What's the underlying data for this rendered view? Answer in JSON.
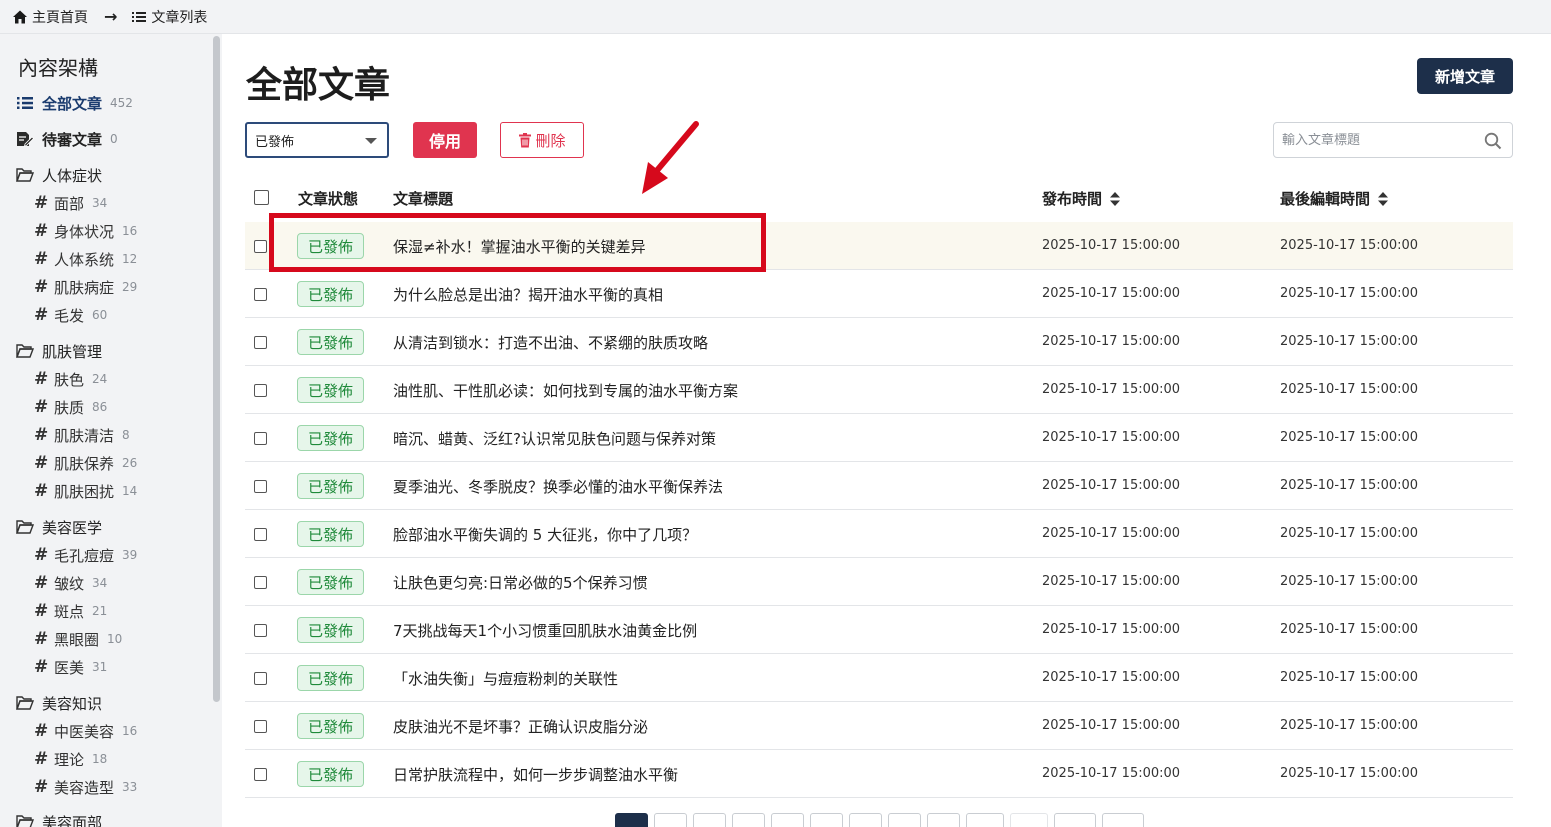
{
  "breadcrumb": {
    "home": "主頁首頁",
    "current": "文章列表"
  },
  "sidebar": {
    "title": "內容架構",
    "all": {
      "label": "全部文章",
      "count": "452"
    },
    "pending": {
      "label": "待審文章",
      "count": "0"
    },
    "groups": [
      {
        "label": "人体症状",
        "items": [
          {
            "label": "面部",
            "count": "34"
          },
          {
            "label": "身体状况",
            "count": "16"
          },
          {
            "label": "人体系统",
            "count": "12"
          },
          {
            "label": "肌肤病症",
            "count": "29"
          },
          {
            "label": "毛发",
            "count": "60"
          }
        ]
      },
      {
        "label": "肌肤管理",
        "items": [
          {
            "label": "肤色",
            "count": "24"
          },
          {
            "label": "肤质",
            "count": "86"
          },
          {
            "label": "肌肤清洁",
            "count": "8"
          },
          {
            "label": "肌肤保养",
            "count": "26"
          },
          {
            "label": "肌肤困扰",
            "count": "14"
          }
        ]
      },
      {
        "label": "美容医学",
        "items": [
          {
            "label": "毛孔痘痘",
            "count": "39"
          },
          {
            "label": "皱纹",
            "count": "34"
          },
          {
            "label": "斑点",
            "count": "21"
          },
          {
            "label": "黑眼圈",
            "count": "10"
          },
          {
            "label": "医美",
            "count": "31"
          }
        ]
      },
      {
        "label": "美容知识",
        "items": [
          {
            "label": "中医美容",
            "count": "16"
          },
          {
            "label": "理论",
            "count": "18"
          },
          {
            "label": "美容造型",
            "count": "33"
          }
        ]
      },
      {
        "label": "美容面部",
        "items": []
      }
    ]
  },
  "page": {
    "title": "全部文章",
    "new_button": "新增文章"
  },
  "toolbar": {
    "status_value": "已發佈",
    "disable_label": "停用",
    "delete_label": "刪除",
    "search_placeholder": "輸入文章標題"
  },
  "table": {
    "headers": {
      "status": "文章狀態",
      "title": "文章標題",
      "published": "發布時間",
      "edited": "最後編輯時間"
    },
    "rows": [
      {
        "status": "已發佈",
        "title": "保湿≠补水！掌握油水平衡的关键差异",
        "published": "2025-10-17 15:00:00",
        "edited": "2025-10-17 15:00:00"
      },
      {
        "status": "已發佈",
        "title": "为什么脸总是出油？揭开油水平衡的真相",
        "published": "2025-10-17 15:00:00",
        "edited": "2025-10-17 15:00:00"
      },
      {
        "status": "已發佈",
        "title": "从清洁到锁水：打造不出油、不紧绷的肤质攻略",
        "published": "2025-10-17 15:00:00",
        "edited": "2025-10-17 15:00:00"
      },
      {
        "status": "已發佈",
        "title": "油性肌、干性肌必读：如何找到专属的油水平衡方案",
        "published": "2025-10-17 15:00:00",
        "edited": "2025-10-17 15:00:00"
      },
      {
        "status": "已發佈",
        "title": "暗沉、蜡黄、泛红?认识常见肤色问题与保养对策",
        "published": "2025-10-17 15:00:00",
        "edited": "2025-10-17 15:00:00"
      },
      {
        "status": "已發佈",
        "title": "夏季油光、冬季脱皮？换季必懂的油水平衡保养法",
        "published": "2025-10-17 15:00:00",
        "edited": "2025-10-17 15:00:00"
      },
      {
        "status": "已發佈",
        "title": "脸部油水平衡失调的 5 大征兆，你中了几项？",
        "published": "2025-10-17 15:00:00",
        "edited": "2025-10-17 15:00:00"
      },
      {
        "status": "已發佈",
        "title": "让肤色更匀亮:日常必做的5个保养习惯",
        "published": "2025-10-17 15:00:00",
        "edited": "2025-10-17 15:00:00"
      },
      {
        "status": "已發佈",
        "title": "7天挑战每天1个小习惯重回肌肤水油黄金比例",
        "published": "2025-10-17 15:00:00",
        "edited": "2025-10-17 15:00:00"
      },
      {
        "status": "已發佈",
        "title": "「水油失衡」与痘痘粉刺的关联性",
        "published": "2025-10-17 15:00:00",
        "edited": "2025-10-17 15:00:00"
      },
      {
        "status": "已發佈",
        "title": "皮肤油光不是坏事？正确认识皮脂分泌",
        "published": "2025-10-17 15:00:00",
        "edited": "2025-10-17 15:00:00"
      },
      {
        "status": "已發佈",
        "title": "日常护肤流程中，如何一步步调整油水平衡",
        "published": "2025-10-17 15:00:00",
        "edited": "2025-10-17 15:00:00"
      }
    ]
  },
  "colors": {
    "brand_dark": "#1d2f4a",
    "danger": "#e0344f",
    "published_badge": "#1f8a3a",
    "annotation": "#d6091c"
  }
}
